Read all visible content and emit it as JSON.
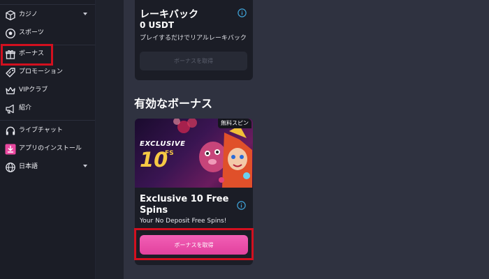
{
  "sidebar": {
    "items": [
      {
        "label": "カジノ",
        "icon": "casino-icon",
        "caret": true
      },
      {
        "label": "スポーツ",
        "icon": "soccer-ball-icon",
        "caret": false
      },
      {
        "label": "ボーナス",
        "icon": "gift-icon",
        "caret": false,
        "highlighted": true
      },
      {
        "label": "プロモーション",
        "icon": "tag-icon",
        "caret": false
      },
      {
        "label": "VIPクラブ",
        "icon": "crown-icon",
        "caret": false
      },
      {
        "label": "紹介",
        "icon": "megaphone-icon",
        "caret": false
      },
      {
        "label": "ライブチャット",
        "icon": "headset-icon",
        "caret": false
      },
      {
        "label": "アプリのインストール",
        "icon": "download-icon",
        "caret": false
      },
      {
        "label": "日本語",
        "icon": "globe-icon",
        "caret": true
      }
    ]
  },
  "rakeback": {
    "title": "レーキバック",
    "amount": "0 USDT",
    "subtitle": "プレイするだけでリアルレーキバック",
    "button_label": "ボーナスを取得"
  },
  "active_bonuses": {
    "section_title": "有効なボーナス",
    "card": {
      "badge": "無料スピン",
      "banner_exclusive": "EXCLUSIVE",
      "banner_number": "10",
      "banner_unit": "FS",
      "title": "Exclusive 10 Free Spins",
      "subtitle": "Your No Deposit Free Spins!",
      "button_label": "ボーナスを取得"
    }
  },
  "colors": {
    "accent_pink": "#e9489f",
    "highlight_red": "#d2101f",
    "info_blue": "#3fa3d8",
    "sidebar_bg": "#1b1d26",
    "content_bg": "#2f3240"
  }
}
